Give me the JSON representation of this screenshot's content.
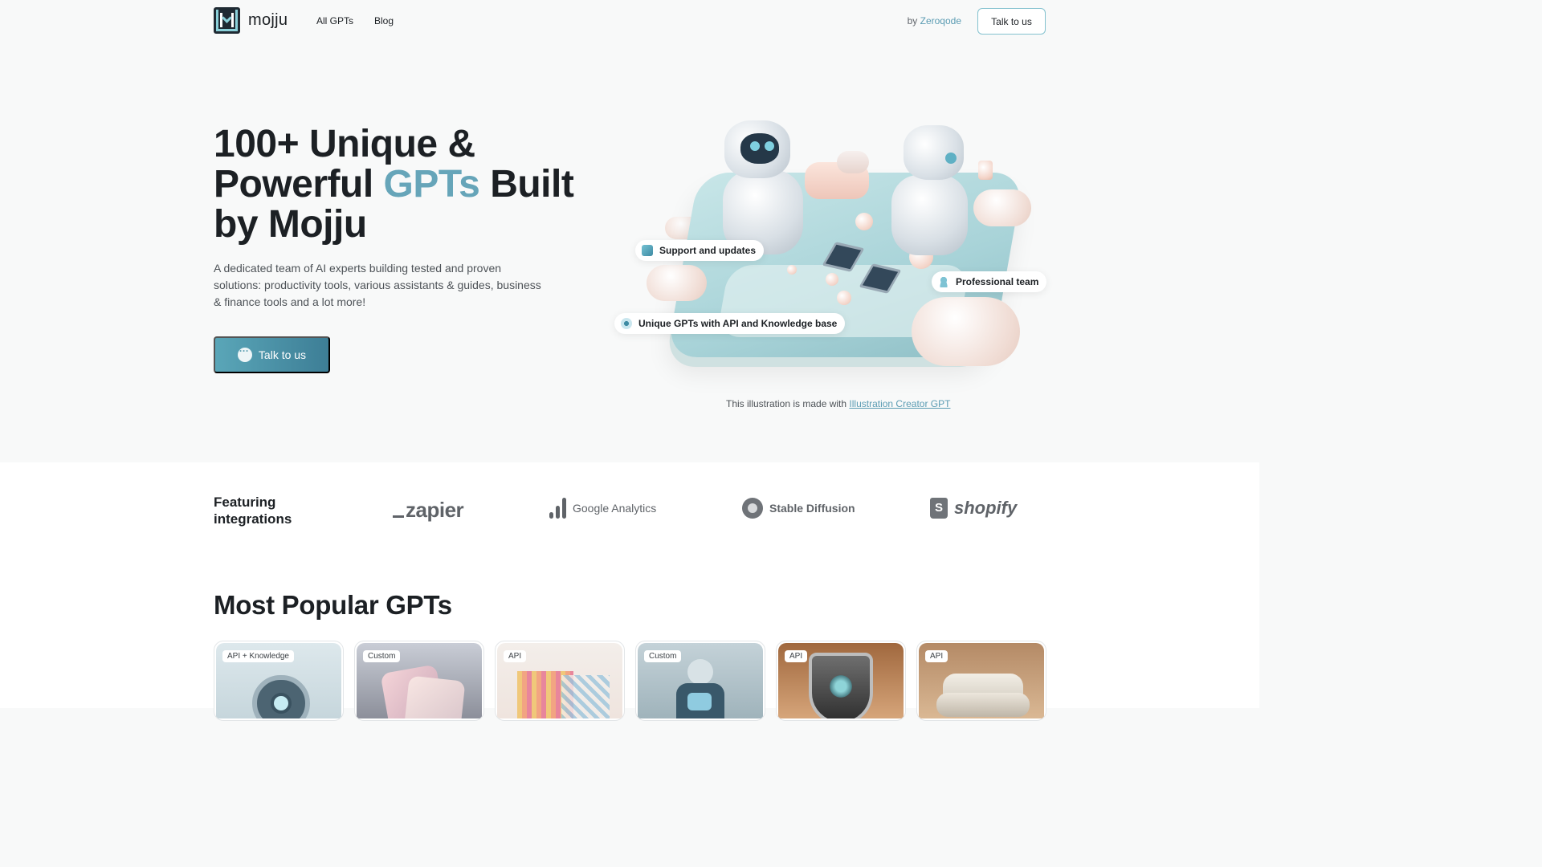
{
  "nav": {
    "logo_text": "mojju",
    "links": [
      "All GPTs",
      "Blog"
    ],
    "by_prefix": "by",
    "by_link": "Zeroqode",
    "cta": "Talk to us"
  },
  "hero": {
    "title_part1": "100+ Unique &",
    "title_part2": "Powerful",
    "title_accent": "GPTs",
    "title_part3": "Built",
    "title_part4": "by Mojju",
    "description": "A dedicated team of AI experts building tested and proven solutions: productivity tools, various assistants & guides, business & finance tools and a lot more!",
    "cta": "Talk to us",
    "pills": [
      "Support and updates",
      "Professional team",
      "Unique GPTs with API and Knowledge base"
    ],
    "caption_prefix": "This illustration is made with",
    "caption_link": "Illustration Creator GPT"
  },
  "integrations": {
    "title": "Featuring integrations",
    "brands": [
      "zapier",
      "Google Analytics",
      "Stable Diffusion",
      "shopify"
    ]
  },
  "popular": {
    "title": "Most Popular GPTs",
    "cards": [
      {
        "tag": "API + Knowledge"
      },
      {
        "tag": "Custom"
      },
      {
        "tag": "API"
      },
      {
        "tag": "Custom"
      },
      {
        "tag": "API"
      },
      {
        "tag": "API"
      }
    ]
  },
  "colors": {
    "accent": "#66a5b9",
    "button_gradient_start": "#5aa6b8",
    "button_gradient_end": "#3d7e96",
    "link": "#5b9cb3"
  }
}
